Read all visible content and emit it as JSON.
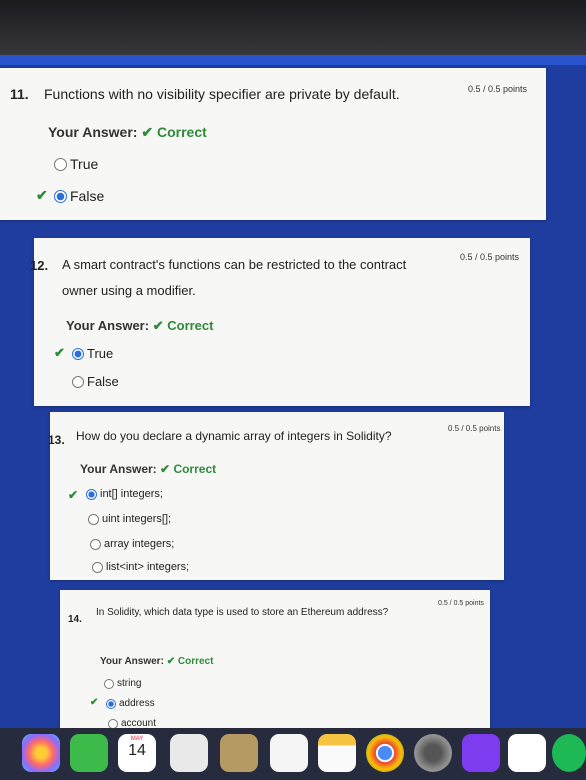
{
  "questions": [
    {
      "number": "11.",
      "text": "Functions with no visibility specifier are private by default.",
      "points": "0.5 / 0.5 points",
      "answer_label": "Your Answer:",
      "answer_status": "Correct",
      "options": [
        "True",
        "False"
      ],
      "selected_index": 1
    },
    {
      "number": "12.",
      "text": "A smart contract's functions can be restricted to the contract owner using a modifier.",
      "points": "0.5 / 0.5 points",
      "answer_label": "Your Answer:",
      "answer_status": "Correct",
      "options": [
        "True",
        "False"
      ],
      "selected_index": 0
    },
    {
      "number": "13.",
      "text": "How do you declare a dynamic array of integers in Solidity?",
      "points": "0.5 / 0.5 points",
      "answer_label": "Your Answer:",
      "answer_status": "Correct",
      "options": [
        "int[] integers;",
        "uint integers[];",
        "array integers;",
        "list<int> integers;"
      ],
      "selected_index": 0
    },
    {
      "number": "14.",
      "text": "In Solidity, which data type is used to store an Ethereum address?",
      "points": "0.5 / 0.5 points",
      "answer_label": "Your Answer:",
      "answer_status": "Correct",
      "options": [
        "string",
        "address",
        "account"
      ],
      "selected_index": 1
    }
  ],
  "dock": {
    "calendar_month": "MAY",
    "calendar_day": "14",
    "icons": [
      "photos-icon",
      "facetime-icon",
      "calendar-icon",
      "freeform-icon",
      "notes-tan-icon",
      "reminders-icon",
      "notes-icon",
      "chrome-icon",
      "settings-icon",
      "github-icon",
      "vscode-icon",
      "spotify-icon"
    ]
  },
  "colors": {
    "background": "#1f3d9e",
    "correct": "#2f8a3a",
    "radio_selected": "#2c6fdc"
  }
}
